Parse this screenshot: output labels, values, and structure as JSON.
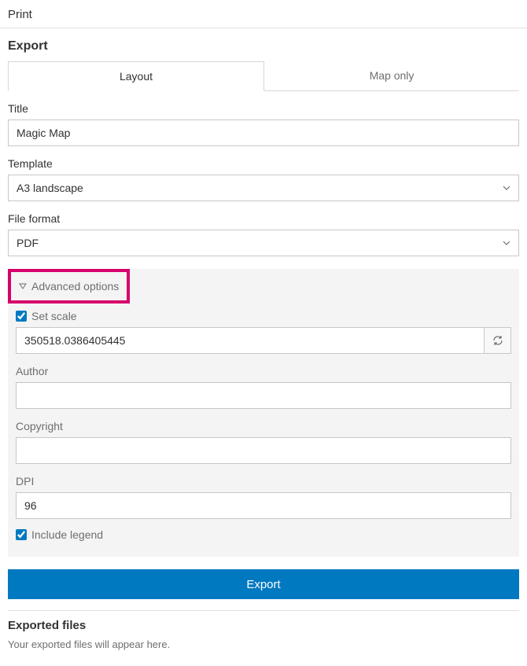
{
  "panel": {
    "header": "Print"
  },
  "export": {
    "title": "Export",
    "tabs": {
      "layout": "Layout",
      "maponly": "Map only",
      "activeIndex": 0
    },
    "fields": {
      "titleLabel": "Title",
      "titleValue": "Magic Map",
      "templateLabel": "Template",
      "templateValue": "A3 landscape",
      "formatLabel": "File format",
      "formatValue": "PDF"
    },
    "advanced": {
      "toggleLabel": "Advanced options",
      "setScaleLabel": "Set scale",
      "setScaleChecked": true,
      "scaleValue": "350518.0386405445",
      "authorLabel": "Author",
      "authorValue": "",
      "copyrightLabel": "Copyright",
      "copyrightValue": "",
      "dpiLabel": "DPI",
      "dpiValue": "96",
      "includeLegendLabel": "Include legend",
      "includeLegendChecked": true
    },
    "button": "Export"
  },
  "exported": {
    "title": "Exported files",
    "message": "Your exported files will appear here."
  }
}
